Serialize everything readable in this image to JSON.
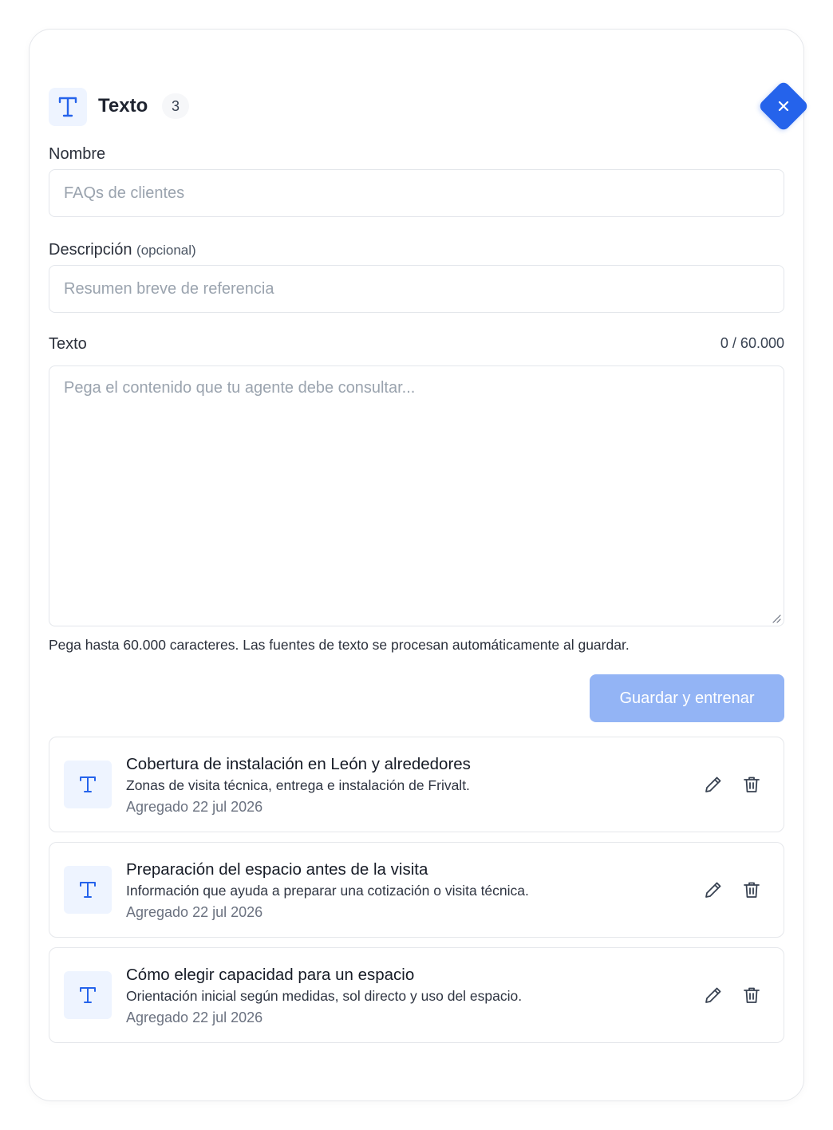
{
  "header": {
    "title": "Texto",
    "count": "3",
    "icon": "text-t-icon",
    "accent_color": "#2563eb"
  },
  "form": {
    "name": {
      "label": "Nombre",
      "placeholder": "FAQs de clientes",
      "value": ""
    },
    "description": {
      "label": "Descripción",
      "optional_label": "(opcional)",
      "placeholder": "Resumen breve de referencia",
      "value": ""
    },
    "text": {
      "label": "Texto",
      "counter": "0 / 60.000",
      "placeholder": "Pega el contenido que tu agente debe consultar...",
      "value": ""
    },
    "hint": "Pega hasta 60.000 caracteres. Las fuentes de texto se procesan automáticamente al guardar.",
    "save_label": "Guardar y entrenar"
  },
  "sources": [
    {
      "title": "Cobertura de instalación en León y alrededores",
      "description": "Zonas de visita técnica, entrega e instalación de Frivalt.",
      "date": "Agregado 22 jul 2026"
    },
    {
      "title": "Preparación del espacio antes de la visita",
      "description": "Información que ayuda a preparar una cotización o visita técnica.",
      "date": "Agregado 22 jul 2026"
    },
    {
      "title": "Cómo elegir capacidad para un espacio",
      "description": "Orientación inicial según medidas, sol directo y uso del espacio.",
      "date": "Agregado 22 jul 2026"
    }
  ]
}
